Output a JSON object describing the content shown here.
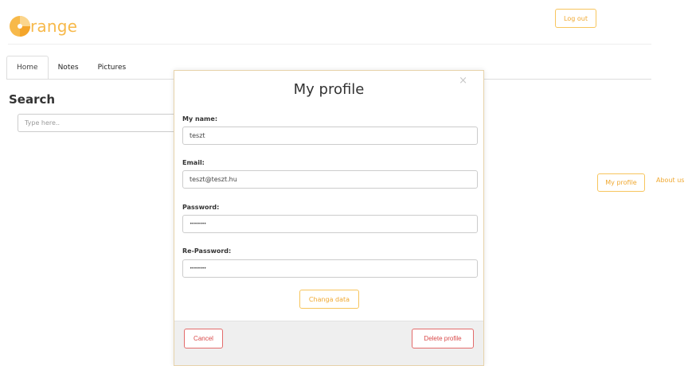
{
  "header": {
    "logo_text": "range",
    "logout_label": "Log out"
  },
  "tabs": [
    {
      "label": "Home",
      "active": true
    },
    {
      "label": "Notes",
      "active": false
    },
    {
      "label": "Pictures",
      "active": false
    }
  ],
  "search": {
    "title": "Search",
    "placeholder": "Type here.."
  },
  "side_links": {
    "my_profile": "My profile",
    "about_us": "About us"
  },
  "modal": {
    "title": "My profile",
    "close_glyph": "×",
    "fields": [
      {
        "label": "My name:",
        "value": "teszt"
      },
      {
        "label": "Email:",
        "value": "teszt@teszt.hu"
      },
      {
        "label": "Password:",
        "value": "••••••••"
      },
      {
        "label": "Re-Password:",
        "value": "••••••••"
      }
    ],
    "change_button": "Changa data",
    "cancel_button": "Cancel",
    "delete_button": "Delete profile"
  },
  "colors": {
    "accent": "#f0a830",
    "danger": "#d94a4a"
  }
}
